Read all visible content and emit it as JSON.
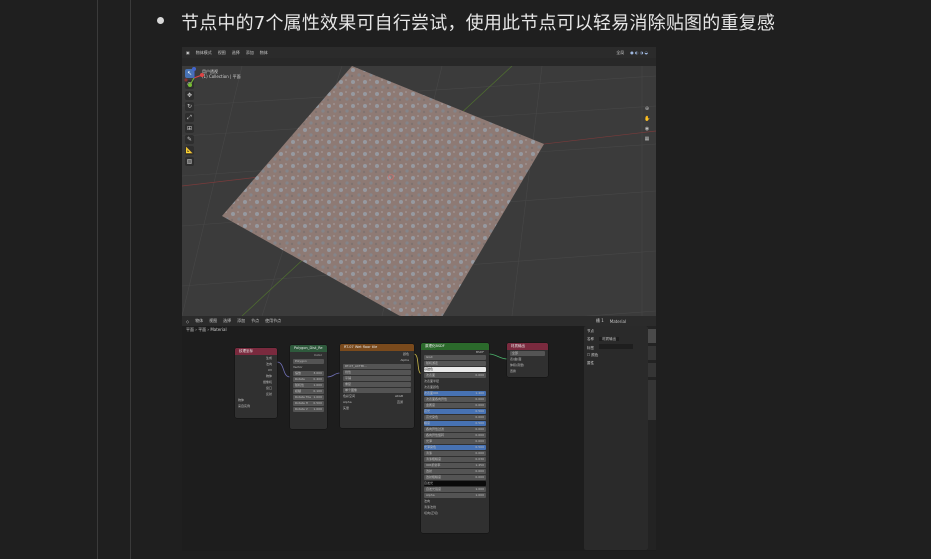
{
  "heading": "节点中的7个属性效果可自行尝试，使用此节点可以轻易消除贴图的重复感",
  "screenshot": {
    "viewport_header": {
      "mode": "物体模式",
      "menus": [
        "视图",
        "选择",
        "添加",
        "物体"
      ],
      "transform": "全局"
    },
    "viewport_info": {
      "view": "用户透视",
      "collection": "(1) Collection | 平面"
    },
    "tools": [
      "select",
      "cursor",
      "move",
      "rotate",
      "scale",
      "transform",
      "annotate",
      "measure",
      "add"
    ],
    "node_header": {
      "editor": "物体",
      "menus": [
        "视图",
        "选择",
        "添加",
        "节点"
      ],
      "use_nodes": "使用节点",
      "slot": "槽 1",
      "material": "Material"
    },
    "breadcrumb": [
      "平面",
      "平面",
      "Material"
    ],
    "nodes": {
      "texcoord": {
        "title": "纹理坐标",
        "outputs": [
          "生成",
          "法向",
          "UV",
          "物体",
          "摄像机",
          "窗口",
          "反射"
        ],
        "object_label": "物体",
        "from_instancer": "来自实例"
      },
      "group": {
        "title": "Polygon_Dist_Re",
        "group_name": "Polygon",
        "inputs": [
          {
            "label": "Vector",
            "value": ""
          },
          {
            "label": "缩放",
            "value": "3.000"
          },
          {
            "label": "Rotate",
            "value": "0.400"
          },
          {
            "label": "随机性",
            "value": "1.000"
          },
          {
            "label": "模糊",
            "value": "0.100"
          },
          {
            "label": "Rotate Tile",
            "value": "1.000"
          },
          {
            "label": "Rotate H",
            "value": "0.500"
          },
          {
            "label": "Rotate V",
            "value": "1.000"
          }
        ],
        "output": "Color"
      },
      "image": {
        "title": "RT-07 Wet floor tile",
        "image_name": "RT-07_ACTMI...",
        "outputs": [
          "颜色",
          "Alpha"
        ],
        "fields": [
          {
            "label": "线性",
            "value": ""
          },
          {
            "label": "平铺",
            "value": ""
          },
          {
            "label": "重复",
            "value": ""
          },
          {
            "label": "单个图像",
            "value": ""
          },
          {
            "label": "色彩空间",
            "value": "sRGB"
          },
          {
            "label": "Alpha",
            "value": "直通"
          }
        ],
        "vector": "矢量"
      },
      "bsdf": {
        "title": "原理化BSDF",
        "output": "BSDF",
        "selects": [
          "GGX",
          "随机游走"
        ],
        "rows": [
          {
            "label": "基础色",
            "value": ""
          },
          {
            "label": "次表面",
            "value": "0.000"
          },
          {
            "label": "次表面半径",
            "value": ""
          },
          {
            "label": "次表面颜色",
            "value": ""
          },
          {
            "label": "次表面IOR",
            "value": "1.400"
          },
          {
            "label": "次表面各向异性",
            "value": "0.000"
          },
          {
            "label": "金属度",
            "value": "0.000"
          },
          {
            "label": "高光",
            "value": "0.500"
          },
          {
            "label": "高光染色",
            "value": "0.000"
          },
          {
            "label": "糙度",
            "value": "0.500"
          },
          {
            "label": "各向异性过滤",
            "value": "0.000"
          },
          {
            "label": "各向异性旋转",
            "value": "0.000"
          },
          {
            "label": "光泽",
            "value": "0.000"
          },
          {
            "label": "光泽染色",
            "value": "0.500"
          },
          {
            "label": "清漆",
            "value": "0.000"
          },
          {
            "label": "清漆粗糙度",
            "value": "0.030"
          },
          {
            "label": "IOR折射率",
            "value": "1.450"
          },
          {
            "label": "透射",
            "value": "0.000"
          },
          {
            "label": "透射粗糙度",
            "value": "0.000"
          },
          {
            "label": "自发光",
            "value": ""
          },
          {
            "label": "自发光强度",
            "value": "1.000"
          },
          {
            "label": "Alpha",
            "value": "1.000"
          },
          {
            "label": "法向",
            "value": ""
          },
          {
            "label": "清漆法线",
            "value": ""
          },
          {
            "label": "切向(正切)",
            "value": ""
          }
        ]
      },
      "output": {
        "title": "材质输出",
        "target": "全部",
        "inputs": [
          "表(曲)面",
          "体积(音量)",
          "置换"
        ]
      }
    },
    "npanel": {
      "section": "节点",
      "name_label": "名称",
      "name_value": "材质输出",
      "label_label": "标签",
      "color_label": "颜色",
      "props_label": "属性"
    },
    "ntabs": [
      "节点",
      "工具",
      "视图",
      "Node Wrangler"
    ]
  }
}
